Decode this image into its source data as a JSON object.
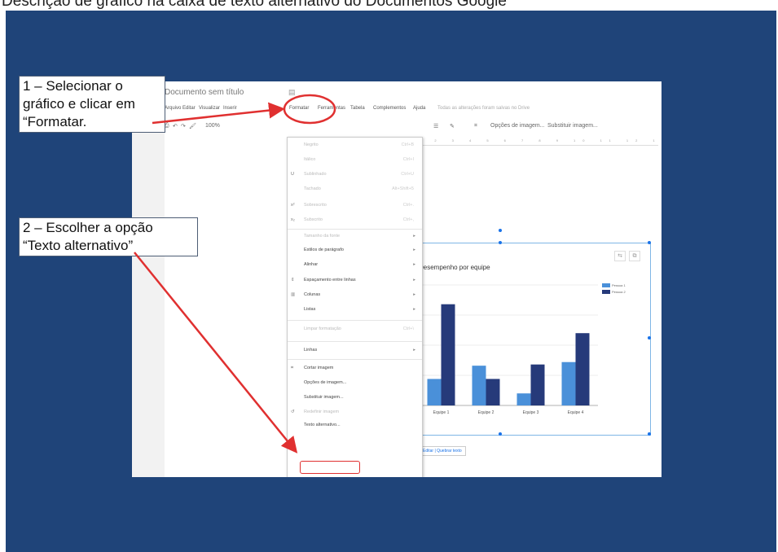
{
  "top_caption": "Descrição de gráfico na caixa de texto alternativo do Documentos Google",
  "annotations": {
    "step1": "1 – Selecionar o gráfico e clicar em “Formatar.",
    "step2": "2 – Escolher a opção “Texto alternativo”"
  },
  "docs": {
    "title": "Documento sem título",
    "menu": [
      "Arquivo",
      "Editar",
      "Visualizar",
      "Inserir",
      "Formatar",
      "Ferramentas",
      "Tabela",
      "Complementos",
      "Ajuda"
    ],
    "save_note": "Todas as alterações foram salvas no Drive",
    "toolbar": {
      "zoom": "100%",
      "image_options": "Opções de imagem...",
      "replace_image": "Substituir imagem..."
    },
    "format_menu": [
      {
        "label": "Negrito",
        "shortcut": "Ctrl+B",
        "disabled": true
      },
      {
        "label": "Itálico",
        "shortcut": "Ctrl+I",
        "disabled": true
      },
      {
        "label": "Sublinhado",
        "shortcut": "Ctrl+U",
        "disabled": true
      },
      {
        "label": "Tachado",
        "shortcut": "Alt+Shift+5",
        "disabled": true
      },
      {
        "label": "Sobrescrito",
        "shortcut": "Ctrl+.",
        "disabled": true
      },
      {
        "label": "Subscrito",
        "shortcut": "Ctrl+,",
        "disabled": true
      },
      {
        "label": "Tamanho da fonte",
        "arrow": true,
        "disabled": true
      },
      {
        "label": "Estilos de parágrafo",
        "arrow": true
      },
      {
        "label": "Alinhar",
        "arrow": true
      },
      {
        "label": "Espaçamento entre linhas",
        "arrow": true
      },
      {
        "label": "Colunas",
        "arrow": true
      },
      {
        "label": "Listas",
        "arrow": true
      },
      {
        "label": "Limpar formatação",
        "shortcut": "Ctrl+\\",
        "disabled": true
      },
      {
        "label": "Linhas",
        "arrow": true
      },
      {
        "label": "Cortar imagem"
      },
      {
        "label": "Opções de imagem..."
      },
      {
        "label": "Substituir imagem..."
      },
      {
        "label": "Redefinir imagem",
        "disabled": true
      },
      {
        "label": "Texto alternativo..."
      }
    ],
    "below_chart_link": "Editar | Quebrar texto"
  },
  "chart_data": {
    "type": "bar",
    "title": "Desempenho por equipe",
    "categories": [
      "Equipe 1",
      "Equipe 2",
      "Equipe 3",
      "Equipe 4"
    ],
    "series": [
      {
        "name": "Pessoa 1",
        "values": [
          22,
          33,
          10,
          36
        ],
        "color": "#4a90d9"
      },
      {
        "name": "Pessoa 2",
        "values": [
          84,
          22,
          34,
          60
        ],
        "color": "#263a7a"
      }
    ],
    "ylim": [
      0,
      100
    ],
    "grid": true,
    "legend": "top-right"
  },
  "colors": {
    "slide_bg": "#1f4479",
    "annotation_red": "#e03030"
  }
}
